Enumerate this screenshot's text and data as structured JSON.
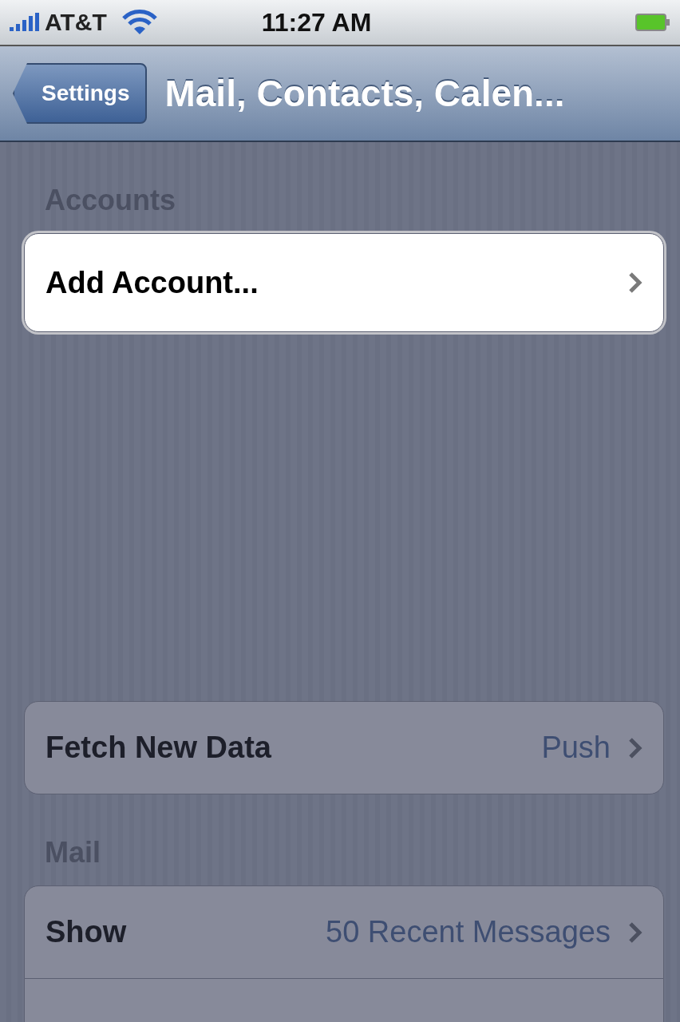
{
  "status_bar": {
    "carrier": "AT&T",
    "time": "11:27 AM"
  },
  "nav_bar": {
    "back_button": "Settings",
    "title": "Mail, Contacts, Calen..."
  },
  "sections": [
    {
      "header": "Accounts",
      "rows": [
        {
          "label": "Add Account...",
          "highlighted": true
        }
      ]
    },
    {
      "rows": [
        {
          "label": "Fetch New Data",
          "value": "Push",
          "highlighted": false
        }
      ]
    },
    {
      "header": "Mail",
      "rows": [
        {
          "label": "Show",
          "value": "50 Recent Messages",
          "highlighted": false
        },
        {
          "highlighted": false
        }
      ]
    }
  ]
}
